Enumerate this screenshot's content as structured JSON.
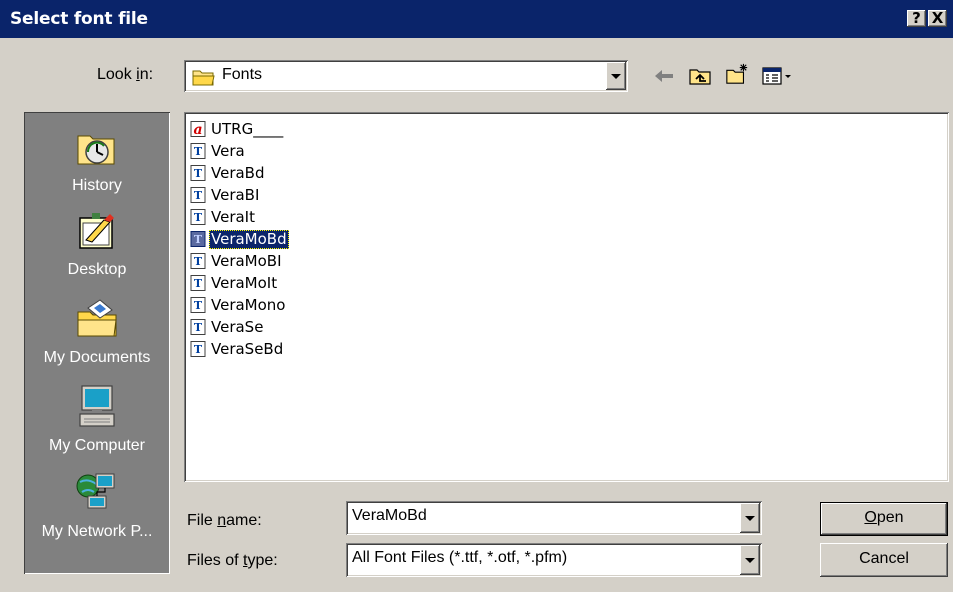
{
  "window": {
    "title": "Select font file",
    "help_label": "?",
    "close_label": "X"
  },
  "look_in": {
    "label_pre": "Look ",
    "label_accel": "i",
    "label_post": "n:",
    "value": "Fonts"
  },
  "places": [
    {
      "label": "History",
      "icon": "history-icon"
    },
    {
      "label": "Desktop",
      "icon": "desktop-icon"
    },
    {
      "label": "My Documents",
      "icon": "my-documents-icon"
    },
    {
      "label": "My Computer",
      "icon": "my-computer-icon"
    },
    {
      "label": "My Network P...",
      "icon": "my-network-places-icon"
    }
  ],
  "files": [
    {
      "name": "UTRG____",
      "icon": "adobe-font-icon"
    },
    {
      "name": "Vera",
      "icon": "truetype-font-icon"
    },
    {
      "name": "VeraBd",
      "icon": "truetype-font-icon"
    },
    {
      "name": "VeraBI",
      "icon": "truetype-font-icon"
    },
    {
      "name": "VeraIt",
      "icon": "truetype-font-icon"
    },
    {
      "name": "VeraMoBd",
      "icon": "truetype-font-icon",
      "selected": true
    },
    {
      "name": "VeraMoBI",
      "icon": "truetype-font-icon"
    },
    {
      "name": "VeraMoIt",
      "icon": "truetype-font-icon"
    },
    {
      "name": "VeraMono",
      "icon": "truetype-font-icon"
    },
    {
      "name": "VeraSe",
      "icon": "truetype-font-icon"
    },
    {
      "name": "VeraSeBd",
      "icon": "truetype-font-icon"
    }
  ],
  "file_name": {
    "label_pre": "File ",
    "label_accel": "n",
    "label_post": "ame:",
    "value": "VeraMoBd"
  },
  "file_type": {
    "label_pre": "Files of ",
    "label_accel": "t",
    "label_post": "ype:",
    "value": "All Font Files (*.ttf, *.otf, *.pfm)"
  },
  "buttons": {
    "open_accel": "O",
    "open_rest": "pen",
    "cancel": "Cancel"
  },
  "colors": {
    "titlebar": "#0a246a",
    "dialog_bg": "#d4d0c8",
    "places_bg": "#808080",
    "selection": "#0a246a"
  }
}
